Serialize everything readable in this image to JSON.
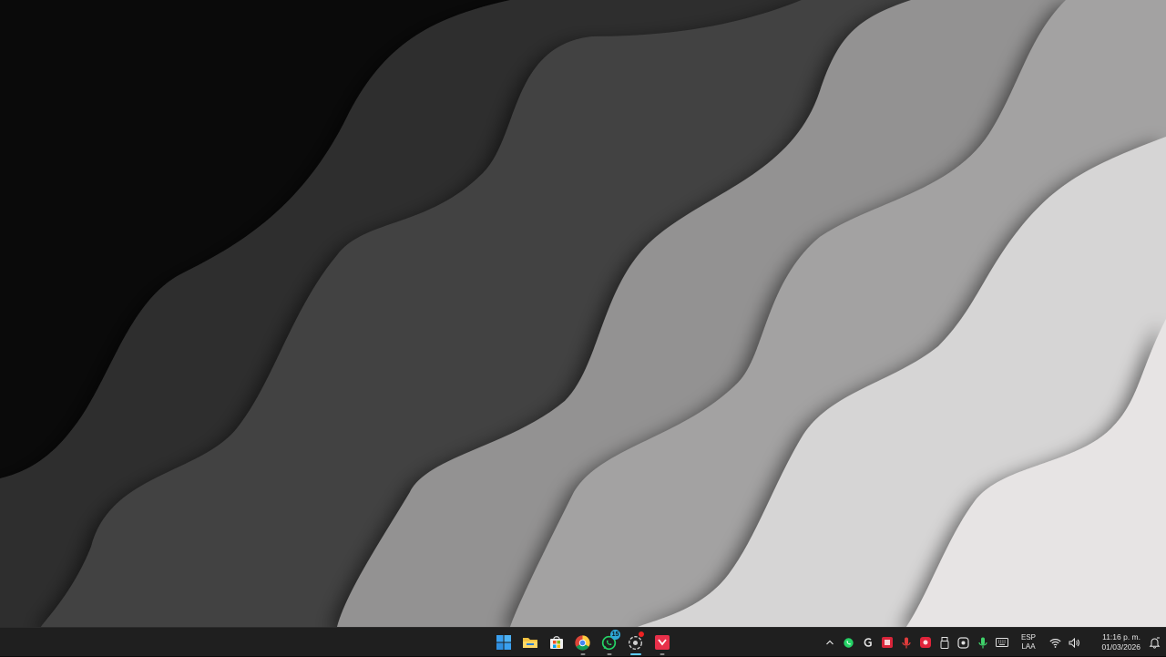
{
  "desktop": {
    "wallpaper": "grayscale-wave-layers",
    "colors": {
      "layer1": "#0a0a0a",
      "layer2": "#2f2f2f",
      "layer3": "#434343",
      "layer4": "#939292",
      "layer5": "#a3a2a2",
      "layer6": "#d6d5d5",
      "layer7": "#e7e4e4"
    }
  },
  "taskbar": {
    "background": "#1f1f1f",
    "pinned_apps": [
      {
        "name": "start-icon",
        "color": "#3aa0f0"
      },
      {
        "name": "file-explorer-icon",
        "color": "#f5c242"
      },
      {
        "name": "microsoft-store-icon",
        "color": "#ffffff"
      },
      {
        "name": "chrome-icon",
        "color": "#4caf50",
        "running": true
      },
      {
        "name": "whatsapp-icon",
        "color": "#25d366",
        "badge": "15",
        "running": true
      },
      {
        "name": "github-desktop-icon",
        "color": "#cfcfcf",
        "running": true,
        "active": true
      },
      {
        "name": "scrumblr-icon",
        "color": "#e8304a",
        "running": true
      }
    ],
    "tray": {
      "icons": [
        "chevron-up-icon",
        "whatsapp-tray-icon",
        "gcode-tray-icon",
        "red-app-tray-icon",
        "microphone-red-tray-icon",
        "red-square-tray-icon",
        "usb-tray-icon",
        "copilot-tray-icon",
        "microphone-tray-icon",
        "keyboard-tray-icon"
      ],
      "language": {
        "line1": "ESP",
        "line2": "LAA"
      },
      "network": "wifi-icon",
      "volume": "volume-icon",
      "clock": {
        "time": "11:16 p. m.",
        "date": "01/03/2026"
      },
      "notifications": "notification-bell-icon"
    }
  }
}
